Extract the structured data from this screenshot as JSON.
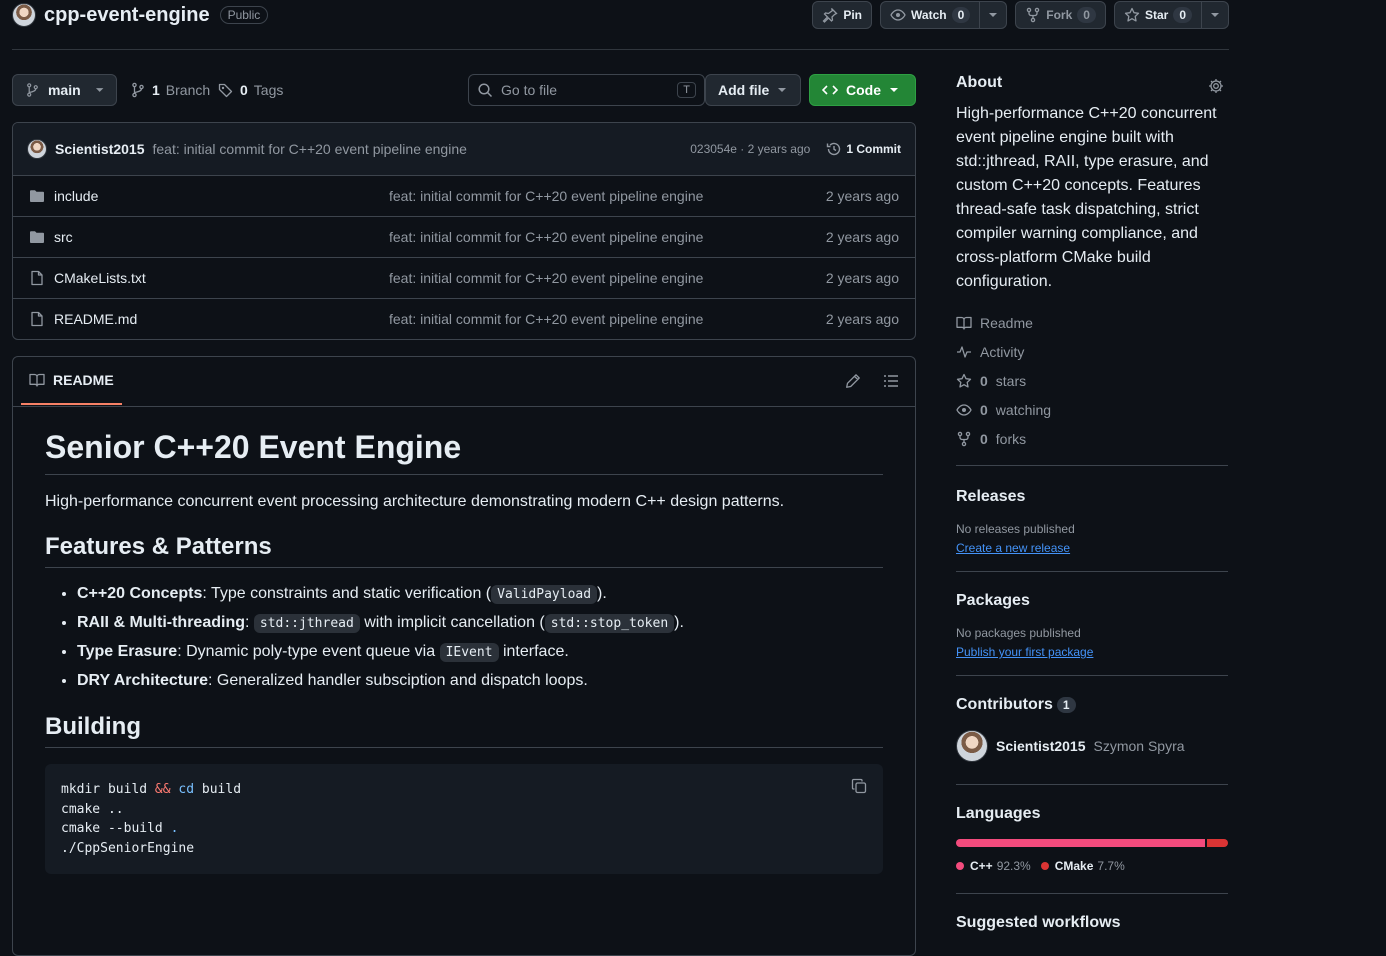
{
  "repo": {
    "name": "cpp-event-engine",
    "visibility": "Public",
    "pin_label": "Pin",
    "watch_label": "Watch",
    "watch_count": "0",
    "fork_label": "Fork",
    "fork_count": "0",
    "star_label": "Star",
    "star_count": "0"
  },
  "nav": {
    "branch": "main",
    "branches_count": "1",
    "branches_label": "Branch",
    "tags_count": "0",
    "tags_label": "Tags",
    "go_to_file_placeholder": "Go to file",
    "go_to_file_shortcut": "T",
    "add_file_label": "Add file",
    "code_label": "Code"
  },
  "latest_commit": {
    "author": "Scientist2015",
    "message": "feat: initial commit for C++20 event pipeline engine",
    "sha_time": "023054e · 2 years ago",
    "commits_label": "1 Commit"
  },
  "files": [
    {
      "name": "include",
      "type": "dir",
      "message": "feat: initial commit for C++20 event pipeline engine",
      "age": "2 years ago"
    },
    {
      "name": "src",
      "type": "dir",
      "message": "feat: initial commit for C++20 event pipeline engine",
      "age": "2 years ago"
    },
    {
      "name": "CMakeLists.txt",
      "type": "file",
      "message": "feat: initial commit for C++20 event pipeline engine",
      "age": "2 years ago"
    },
    {
      "name": "README.md",
      "type": "file",
      "message": "feat: initial commit for C++20 event pipeline engine",
      "age": "2 years ago"
    }
  ],
  "readme": {
    "tab_label": "README",
    "h1": "Senior C++20 Event Engine",
    "intro": "High-performance concurrent event processing architecture demonstrating modern C++ design patterns.",
    "h2_features": "Features & Patterns",
    "features": [
      {
        "strong": "C++20 Concepts",
        "pre": ": Type constraints and static verification (",
        "code": "ValidPayload",
        "post": ")."
      },
      {
        "strong": "RAII & Multi-threading",
        "pre": ": ",
        "code": "std::jthread",
        "mid": " with implicit cancellation (",
        "code2": "std::stop_token",
        "post": ")."
      },
      {
        "strong": "Type Erasure",
        "pre": ": Dynamic poly-type event queue via ",
        "code": "IEvent",
        "post": " interface."
      },
      {
        "strong": "DRY Architecture",
        "pre": ": Generalized handler subsciption and dispatch loops.",
        "code": "",
        "post": ""
      }
    ],
    "h2_building": "Building",
    "code": {
      "l1a": "mkdir build ",
      "l1op": "&&",
      "l1kw": "cd",
      "l1b": " build",
      "l2": "cmake ..",
      "l3a": "cmake --build ",
      "l3b": ".",
      "l4": "./CppSeniorEngine"
    }
  },
  "sidebar": {
    "about_title": "About",
    "about_desc": "High-performance C++20 concurrent event pipeline engine built with std::jthread, RAII, type erasure, and custom C++20 concepts. Features thread-safe task dispatching, strict compiler warning compliance, and cross-platform CMake build configuration.",
    "readme_label": "Readme",
    "activity_label": "Activity",
    "stars": "0",
    "stars_label": "stars",
    "watching": "0",
    "watching_label": "watching",
    "forks": "0",
    "forks_label": "forks",
    "releases_title": "Releases",
    "releases_none": "No releases published",
    "releases_link": "Create a new release",
    "packages_title": "Packages",
    "packages_none": "No packages published",
    "packages_link": "Publish your first package",
    "contributors_title": "Contributors",
    "contributors_count": "1",
    "contributor_login": "Scientist2015",
    "contributor_name": "Szymon Spyra",
    "languages_title": "Languages",
    "languages": [
      {
        "name": "C++",
        "percent": "92.3%",
        "value": 92.3,
        "color": "#f34b7d"
      },
      {
        "name": "CMake",
        "percent": "7.7%",
        "value": 7.7,
        "color": "#da3434"
      }
    ],
    "suggested_title": "Suggested workflows"
  },
  "colors": {
    "bg": "#0d1117",
    "border": "#3d444d",
    "accent_green": "#238636",
    "link": "#4493f8",
    "tab_underline": "#f78166"
  }
}
